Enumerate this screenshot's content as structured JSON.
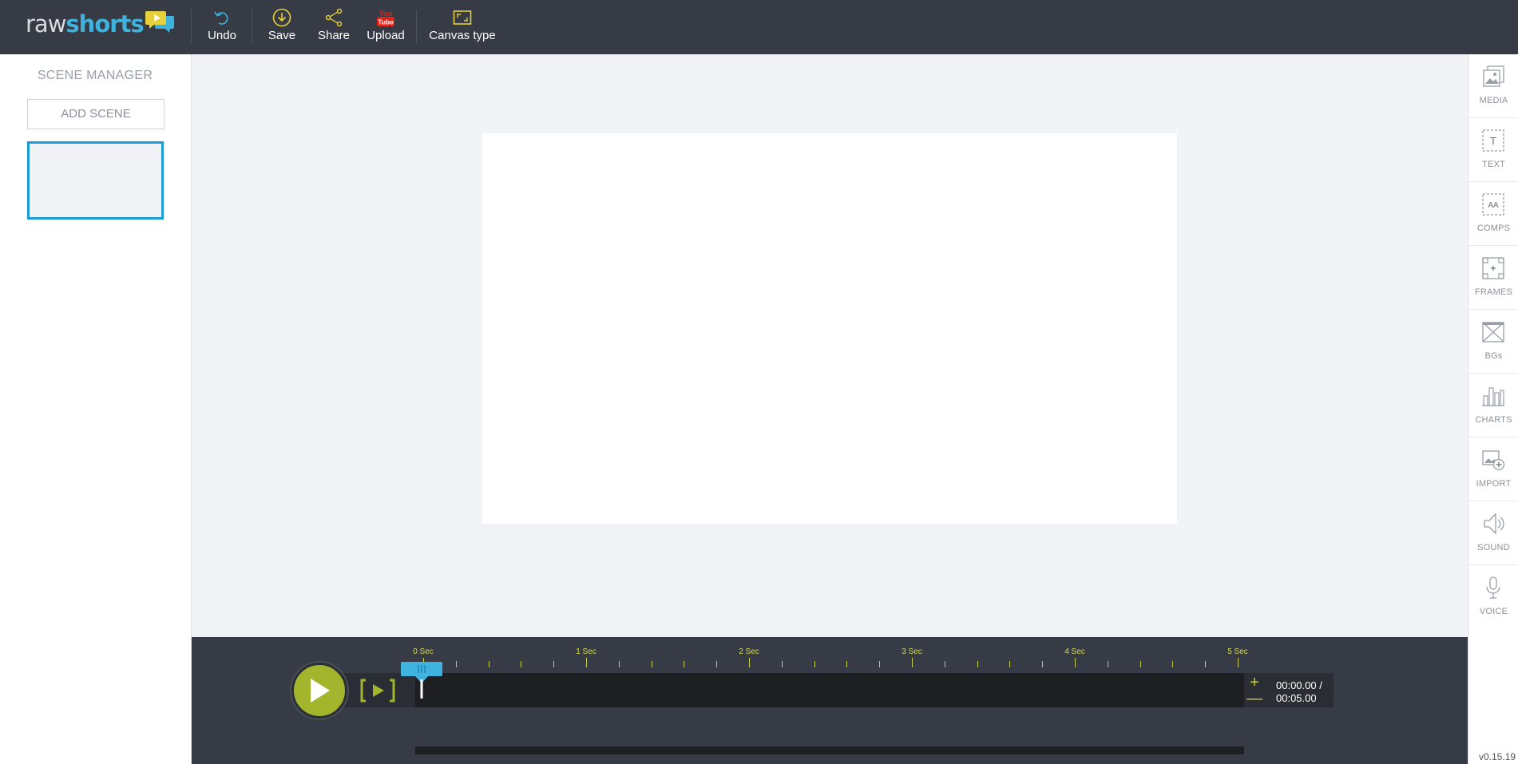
{
  "app": {
    "logo_part1": "raw",
    "logo_part2": "shorts",
    "version": "v0.15.19"
  },
  "toolbar": {
    "undo": "Undo",
    "save": "Save",
    "share": "Share",
    "upload": "Upload",
    "upload_badge_top": "You",
    "upload_badge_bottom": "Tube",
    "canvas_type": "Canvas type"
  },
  "scene_manager": {
    "title": "SCENE MANAGER",
    "add_scene": "ADD SCENE"
  },
  "tools": {
    "media": "MEDIA",
    "text": "TEXT",
    "comps": "COMPS",
    "frames": "FRAMES",
    "bgs": "BGs",
    "charts": "CHARTS",
    "import": "IMPORT",
    "sound": "SOUND",
    "voice": "VOICE"
  },
  "timeline": {
    "ticks": [
      "0 Sec",
      "1 Sec",
      "2 Sec",
      "3 Sec",
      "4 Sec",
      "5 Sec"
    ],
    "current_time": "00:00.00 /",
    "total_time": "00:05.00",
    "zoom_in": "+",
    "zoom_out": "—"
  },
  "colors": {
    "topbar": "#363b45",
    "accent_blue": "#1d9ad8",
    "accent_yellow": "#d6dc49",
    "play_green": "#a3b52d"
  }
}
